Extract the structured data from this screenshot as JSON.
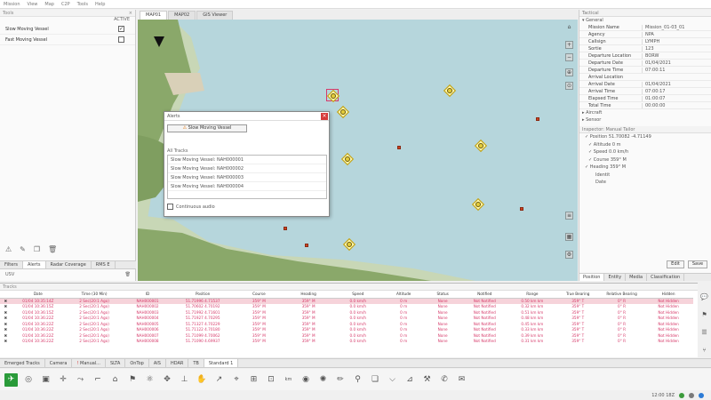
{
  "menu": [
    "Mission",
    "View",
    "Map",
    "C2P",
    "Tools",
    "Help"
  ],
  "left_panel": {
    "title": "Tools",
    "column_header": "ACTIVE",
    "rows": [
      {
        "label": "Slow Moving Vessel",
        "checked": true
      },
      {
        "label": "Fast Moving Vessel",
        "checked": false
      }
    ],
    "tabs": [
      "Filters",
      "Alerts",
      "Radar Coverage",
      "RMS E"
    ],
    "footer_left": "USV"
  },
  "map_tabs": [
    "MAP01",
    "MAP02",
    "GIS Viewer"
  ],
  "map_controls": [
    "+",
    "−",
    "⊕",
    "⊙"
  ],
  "dialog": {
    "title": "Alerts",
    "button_label": "Slow Moving Vessel",
    "list_label": "All Tracks",
    "items": [
      "Slow Moving Vessel: NAH000001",
      "Slow Moving Vessel: NAH000002",
      "Slow Moving Vessel: NAH000003",
      "Slow Moving Vessel: NAH000004"
    ],
    "footer": "Continuous audio"
  },
  "right_panel": {
    "title": "Tactical",
    "section": "General",
    "rows": [
      {
        "k": "Mission Name",
        "v": "Mission_01-03_01"
      },
      {
        "k": "Agency",
        "v": "NPA"
      },
      {
        "k": "Callsign",
        "v": "LYMPH"
      },
      {
        "k": "Sortie",
        "v": "123"
      },
      {
        "k": "Departure Location",
        "v": "BORW"
      },
      {
        "k": "Departure Date",
        "v": "01/04/2021"
      },
      {
        "k": "Departure Time",
        "v": "07:00:11"
      },
      {
        "k": "Arrival Location",
        "v": ""
      },
      {
        "k": "Arrival Date",
        "v": "01/04/2021"
      },
      {
        "k": "Arrival Time",
        "v": "07:00:17"
      },
      {
        "k": "Elapsed Time",
        "v": "01:00:07"
      },
      {
        "k": "Total Time",
        "v": "00:00:00"
      }
    ],
    "subsections": [
      "Aircraft",
      "Sensor"
    ],
    "inspector_title": "Inspector: Manual Tailor",
    "inspector_rows": [
      "✓ Position  51.70082 -4.71149",
      "✓ Altitude  0 m",
      "✓ Speed  0.0 km/h",
      "✓ Course  359° M",
      "✓ Heading  359° M",
      "Identit",
      "Date"
    ],
    "buttons": [
      "Edit",
      "Save"
    ],
    "tabs": [
      "Position",
      "Entity",
      "Media",
      "Classification"
    ]
  },
  "tracks": {
    "title": "Tracks",
    "headers": [
      "",
      "Date",
      "Time (30 Min)",
      "ID",
      "Position",
      "Course",
      "Heading",
      "Speed",
      "Altitude",
      "Status",
      "Notified",
      "Range",
      "True Bearing",
      "Relative Bearing",
      "Hidden"
    ],
    "rows": [
      [
        "✖",
        "01/04 10:35:14Z",
        "2 Sec(20:1 Ago)",
        "NAH000001",
        "51.71996 4.71537",
        "359° M",
        "359° M",
        "0.0 km/h",
        "0 m",
        "None",
        "Not Notified",
        "0.50 km km",
        "359° T",
        "0° R",
        "Not Hidden"
      ],
      [
        "✖",
        "01/04 10:36:15Z",
        "2 Sec(20:1 Ago)",
        "NAH000002",
        "51.70602 4.70192",
        "359° M",
        "359° M",
        "0.0 km/h",
        "0 m",
        "None",
        "Not Notified",
        "0.32 km km",
        "359° T",
        "0° R",
        "Not Hidden"
      ],
      [
        "✖",
        "01/04 10:36:15Z",
        "2 Sec(20:1 Ago)",
        "NAH000003",
        "51.71992 4.71601",
        "359° M",
        "359° M",
        "0.0 km/h",
        "0 m",
        "None",
        "Not Notified",
        "0.51 km km",
        "359° T",
        "0° R",
        "Not Hidden"
      ],
      [
        "✖",
        "01/04 10:36:22Z",
        "2 Sec(20:1 Ago)",
        "NAH000004",
        "51.71927 4.70295",
        "359° M",
        "359° M",
        "0.0 km/h",
        "0 m",
        "None",
        "Not Notified",
        "0.48 km km",
        "359° T",
        "0° R",
        "Not Hidden"
      ],
      [
        "✖",
        "01/04 10:36:22Z",
        "2 Sec(20:1 Ago)",
        "NAH000005",
        "51.71327 4.70229",
        "359° M",
        "359° M",
        "0.0 km/h",
        "0 m",
        "None",
        "Not Notified",
        "0.45 km km",
        "359° T",
        "0° R",
        "Not Hidden"
      ],
      [
        "✖",
        "01/04 10:36:22Z",
        "2 Sec(20:1 Ago)",
        "NAH000006",
        "51.71122 4.70180",
        "359° M",
        "359° M",
        "0.0 km/h",
        "0 m",
        "None",
        "Not Notified",
        "0.33 km km",
        "359° T",
        "0° R",
        "Not Hidden"
      ],
      [
        "✖",
        "01/04 10:36:22Z",
        "2 Sec(20:1 Ago)",
        "NAH000007",
        "51.71099 4.70062",
        "359° M",
        "359° M",
        "0.0 km/h",
        "0 m",
        "None",
        "Not Notified",
        "0.39 km km",
        "359° T",
        "0° R",
        "Not Hidden"
      ],
      [
        "✖",
        "01/04 10:36:22Z",
        "2 Sec(20:1 Ago)",
        "NAH000008",
        "51.71090 4.69937",
        "359° M",
        "359° M",
        "0.0 km/h",
        "0 m",
        "None",
        "Not Notified",
        "0.31 km km",
        "359° T",
        "0° R",
        "Not Hidden"
      ]
    ]
  },
  "bottom_tabs": [
    "Emerged Tracks",
    "Camera",
    "Manual...",
    "SLTA",
    "OnTop",
    "AIS",
    "HDAR",
    "TB",
    "Standard 1"
  ],
  "toolbar_icons": [
    "pointer-icon",
    "target-icon",
    "screen-icon",
    "crosshair-icon",
    "route-icon",
    "corner-icon",
    "tag-icon",
    "flag-icon",
    "satellite-icon",
    "compass-icon",
    "pin-icon",
    "hand-icon",
    "arrow-icon",
    "ruler-icon",
    "grid-icon",
    "zoom-icon",
    "km-label",
    "ring-icon",
    "pan-icon",
    "draw-icon",
    "stamp-icon",
    "book-icon",
    "filter-icon",
    "chart-icon",
    "tool-icon",
    "phone-icon",
    "message-icon"
  ],
  "toolbar_km": "km",
  "status": {
    "text": "12:00 18Z",
    "colors": [
      "#3a9a3a",
      "#7a7a7a",
      "#2b7bd6"
    ]
  }
}
